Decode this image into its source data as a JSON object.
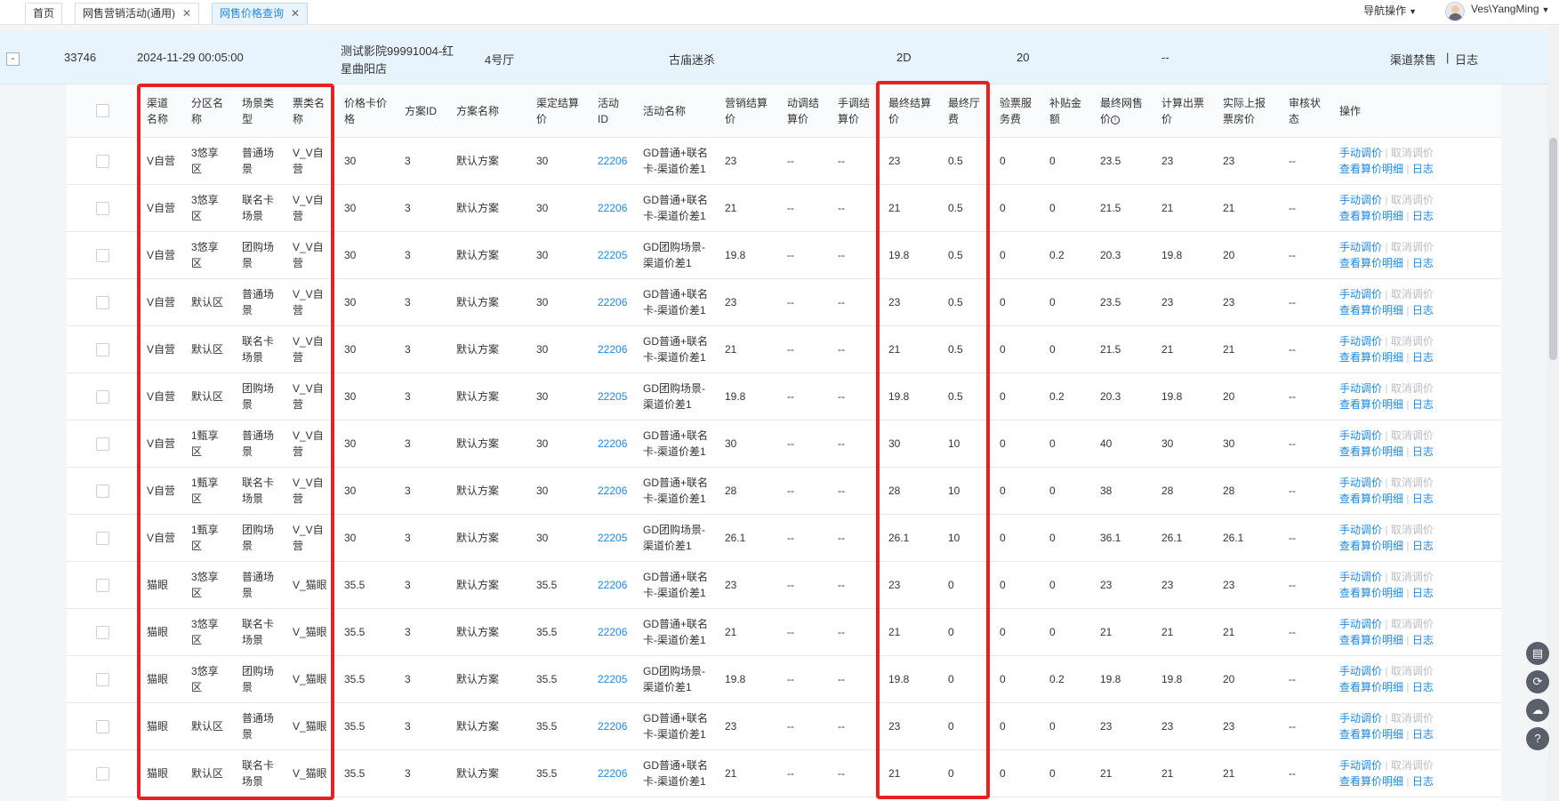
{
  "tabs": [
    {
      "label": "首页",
      "closable": false,
      "active": false
    },
    {
      "label": "网售营销活动(通用)",
      "closable": true,
      "active": false
    },
    {
      "label": "网售价格查询",
      "closable": true,
      "active": true
    }
  ],
  "header": {
    "nav_ops_label": "导航操作",
    "user_name": "Ves\\YangMing"
  },
  "summary": {
    "collapse_symbol": "-",
    "id": "33746",
    "datetime": "2024-11-29 00:05:00",
    "cinema_line1": "测试影院99991004-红",
    "cinema_line2": "星曲阳店",
    "hall": "4号厅",
    "movie": "古庙迷杀",
    "format": "2D",
    "count": "20",
    "dash": "--",
    "action_channel_ban": "渠道禁售",
    "action_log": "日志"
  },
  "columns": [
    {
      "key": "channel",
      "l1": "渠道",
      "l2": "名称"
    },
    {
      "key": "zone",
      "l1": "分区名",
      "l2": "称"
    },
    {
      "key": "scene",
      "l1": "场景类",
      "l2": "型"
    },
    {
      "key": "ticket",
      "l1": "票类名",
      "l2": "称"
    },
    {
      "key": "card",
      "l1": "价格卡价",
      "l2": "格"
    },
    {
      "key": "planid",
      "l1": "方案ID",
      "l2": ""
    },
    {
      "key": "plan",
      "l1": "方案名称",
      "l2": ""
    },
    {
      "key": "settle",
      "l1": "渠定结算",
      "l2": "价"
    },
    {
      "key": "actid",
      "l1": "活动",
      "l2": "ID"
    },
    {
      "key": "act",
      "l1": "活动名称",
      "l2": ""
    },
    {
      "key": "mkt",
      "l1": "营销结算",
      "l2": "价"
    },
    {
      "key": "dyn",
      "l1": "动调结",
      "l2": "算价"
    },
    {
      "key": "man",
      "l1": "手调结",
      "l2": "算价"
    },
    {
      "key": "final",
      "l1": "最终结算",
      "l2": "价"
    },
    {
      "key": "fee",
      "l1": "最终厅",
      "l2": "费"
    },
    {
      "key": "svc",
      "l1": "验票服",
      "l2": "务费"
    },
    {
      "key": "sub",
      "l1": "补贴金",
      "l2": "额"
    },
    {
      "key": "net",
      "l1": "最终网售",
      "l2": "价"
    },
    {
      "key": "calc",
      "l1": "计算出票",
      "l2": "价"
    },
    {
      "key": "rep",
      "l1": "实际上报",
      "l2": "票房价"
    },
    {
      "key": "audit",
      "l1": "审核状",
      "l2": "态"
    },
    {
      "key": "ops",
      "l1": "操作",
      "l2": ""
    }
  ],
  "op_labels": {
    "manual": "手动调价",
    "cancel": "取消调价",
    "detail": "查看算价明细",
    "log": "日志"
  },
  "rows": [
    {
      "channel": "V自营",
      "zone": [
        "3悠享",
        "区"
      ],
      "scene": [
        "普通场",
        "景"
      ],
      "ticket": [
        "V_V自",
        "营"
      ],
      "card": "30",
      "planid": "3",
      "plan": "默认方案",
      "settle": "30",
      "actid": "22206",
      "act": [
        "GD普通+联名",
        "卡-渠道价差1"
      ],
      "mkt": "23",
      "dyn": "--",
      "man": "--",
      "final": "23",
      "fee": "0.5",
      "svc": "0",
      "sub": "0",
      "net": "23.5",
      "calc": "23",
      "rep": "23",
      "audit": "--"
    },
    {
      "channel": "V自营",
      "zone": [
        "3悠享",
        "区"
      ],
      "scene": [
        "联名卡",
        "场景"
      ],
      "ticket": [
        "V_V自",
        "营"
      ],
      "card": "30",
      "planid": "3",
      "plan": "默认方案",
      "settle": "30",
      "actid": "22206",
      "act": [
        "GD普通+联名",
        "卡-渠道价差1"
      ],
      "mkt": "21",
      "dyn": "--",
      "man": "--",
      "final": "21",
      "fee": "0.5",
      "svc": "0",
      "sub": "0",
      "net": "21.5",
      "calc": "21",
      "rep": "21",
      "audit": "--"
    },
    {
      "channel": "V自营",
      "zone": [
        "3悠享",
        "区"
      ],
      "scene": [
        "团购场",
        "景"
      ],
      "ticket": [
        "V_V自",
        "营"
      ],
      "card": "30",
      "planid": "3",
      "plan": "默认方案",
      "settle": "30",
      "actid": "22205",
      "act": [
        "GD团购场景-",
        "渠道价差1"
      ],
      "mkt": "19.8",
      "dyn": "--",
      "man": "--",
      "final": "19.8",
      "fee": "0.5",
      "svc": "0",
      "sub": "0.2",
      "net": "20.3",
      "calc": "19.8",
      "rep": "20",
      "audit": "--"
    },
    {
      "channel": "V自营",
      "zone": [
        "默认区",
        ""
      ],
      "scene": [
        "普通场",
        "景"
      ],
      "ticket": [
        "V_V自",
        "营"
      ],
      "card": "30",
      "planid": "3",
      "plan": "默认方案",
      "settle": "30",
      "actid": "22206",
      "act": [
        "GD普通+联名",
        "卡-渠道价差1"
      ],
      "mkt": "23",
      "dyn": "--",
      "man": "--",
      "final": "23",
      "fee": "0.5",
      "svc": "0",
      "sub": "0",
      "net": "23.5",
      "calc": "23",
      "rep": "23",
      "audit": "--"
    },
    {
      "channel": "V自营",
      "zone": [
        "默认区",
        ""
      ],
      "scene": [
        "联名卡",
        "场景"
      ],
      "ticket": [
        "V_V自",
        "营"
      ],
      "card": "30",
      "planid": "3",
      "plan": "默认方案",
      "settle": "30",
      "actid": "22206",
      "act": [
        "GD普通+联名",
        "卡-渠道价差1"
      ],
      "mkt": "21",
      "dyn": "--",
      "man": "--",
      "final": "21",
      "fee": "0.5",
      "svc": "0",
      "sub": "0",
      "net": "21.5",
      "calc": "21",
      "rep": "21",
      "audit": "--"
    },
    {
      "channel": "V自营",
      "zone": [
        "默认区",
        ""
      ],
      "scene": [
        "团购场",
        "景"
      ],
      "ticket": [
        "V_V自",
        "营"
      ],
      "card": "30",
      "planid": "3",
      "plan": "默认方案",
      "settle": "30",
      "actid": "22205",
      "act": [
        "GD团购场景-",
        "渠道价差1"
      ],
      "mkt": "19.8",
      "dyn": "--",
      "man": "--",
      "final": "19.8",
      "fee": "0.5",
      "svc": "0",
      "sub": "0.2",
      "net": "20.3",
      "calc": "19.8",
      "rep": "20",
      "audit": "--"
    },
    {
      "channel": "V自营",
      "zone": [
        "1甄享",
        "区"
      ],
      "scene": [
        "普通场",
        "景"
      ],
      "ticket": [
        "V_V自",
        "营"
      ],
      "card": "30",
      "planid": "3",
      "plan": "默认方案",
      "settle": "30",
      "actid": "22206",
      "act": [
        "GD普通+联名",
        "卡-渠道价差1"
      ],
      "mkt": "30",
      "dyn": "--",
      "man": "--",
      "final": "30",
      "fee": "10",
      "svc": "0",
      "sub": "0",
      "net": "40",
      "calc": "30",
      "rep": "30",
      "audit": "--"
    },
    {
      "channel": "V自营",
      "zone": [
        "1甄享",
        "区"
      ],
      "scene": [
        "联名卡",
        "场景"
      ],
      "ticket": [
        "V_V自",
        "营"
      ],
      "card": "30",
      "planid": "3",
      "plan": "默认方案",
      "settle": "30",
      "actid": "22206",
      "act": [
        "GD普通+联名",
        "卡-渠道价差1"
      ],
      "mkt": "28",
      "dyn": "--",
      "man": "--",
      "final": "28",
      "fee": "10",
      "svc": "0",
      "sub": "0",
      "net": "38",
      "calc": "28",
      "rep": "28",
      "audit": "--"
    },
    {
      "channel": "V自营",
      "zone": [
        "1甄享",
        "区"
      ],
      "scene": [
        "团购场",
        "景"
      ],
      "ticket": [
        "V_V自",
        "营"
      ],
      "card": "30",
      "planid": "3",
      "plan": "默认方案",
      "settle": "30",
      "actid": "22205",
      "act": [
        "GD团购场景-",
        "渠道价差1"
      ],
      "mkt": "26.1",
      "dyn": "--",
      "man": "--",
      "final": "26.1",
      "fee": "10",
      "svc": "0",
      "sub": "0",
      "net": "36.1",
      "calc": "26.1",
      "rep": "26.1",
      "audit": "--"
    },
    {
      "channel": "猫眼",
      "zone": [
        "3悠享",
        "区"
      ],
      "scene": [
        "普通场",
        "景"
      ],
      "ticket": [
        "V_猫眼",
        ""
      ],
      "card": "35.5",
      "planid": "3",
      "plan": "默认方案",
      "settle": "35.5",
      "actid": "22206",
      "act": [
        "GD普通+联名",
        "卡-渠道价差1"
      ],
      "mkt": "23",
      "dyn": "--",
      "man": "--",
      "final": "23",
      "fee": "0",
      "svc": "0",
      "sub": "0",
      "net": "23",
      "calc": "23",
      "rep": "23",
      "audit": "--"
    },
    {
      "channel": "猫眼",
      "zone": [
        "3悠享",
        "区"
      ],
      "scene": [
        "联名卡",
        "场景"
      ],
      "ticket": [
        "V_猫眼",
        ""
      ],
      "card": "35.5",
      "planid": "3",
      "plan": "默认方案",
      "settle": "35.5",
      "actid": "22206",
      "act": [
        "GD普通+联名",
        "卡-渠道价差1"
      ],
      "mkt": "21",
      "dyn": "--",
      "man": "--",
      "final": "21",
      "fee": "0",
      "svc": "0",
      "sub": "0",
      "net": "21",
      "calc": "21",
      "rep": "21",
      "audit": "--"
    },
    {
      "channel": "猫眼",
      "zone": [
        "3悠享",
        "区"
      ],
      "scene": [
        "团购场",
        "景"
      ],
      "ticket": [
        "V_猫眼",
        ""
      ],
      "card": "35.5",
      "planid": "3",
      "plan": "默认方案",
      "settle": "35.5",
      "actid": "22205",
      "act": [
        "GD团购场景-",
        "渠道价差1"
      ],
      "mkt": "19.8",
      "dyn": "--",
      "man": "--",
      "final": "19.8",
      "fee": "0",
      "svc": "0",
      "sub": "0.2",
      "net": "19.8",
      "calc": "19.8",
      "rep": "20",
      "audit": "--"
    },
    {
      "channel": "猫眼",
      "zone": [
        "默认区",
        ""
      ],
      "scene": [
        "普通场",
        "景"
      ],
      "ticket": [
        "V_猫眼",
        ""
      ],
      "card": "35.5",
      "planid": "3",
      "plan": "默认方案",
      "settle": "35.5",
      "actid": "22206",
      "act": [
        "GD普通+联名",
        "卡-渠道价差1"
      ],
      "mkt": "23",
      "dyn": "--",
      "man": "--",
      "final": "23",
      "fee": "0",
      "svc": "0",
      "sub": "0",
      "net": "23",
      "calc": "23",
      "rep": "23",
      "audit": "--"
    },
    {
      "channel": "猫眼",
      "zone": [
        "默认区",
        ""
      ],
      "scene": [
        "联名卡",
        "场景"
      ],
      "ticket": [
        "V_猫眼",
        ""
      ],
      "card": "35.5",
      "planid": "3",
      "plan": "默认方案",
      "settle": "35.5",
      "actid": "22206",
      "act": [
        "GD普通+联名",
        "卡-渠道价差1"
      ],
      "mkt": "21",
      "dyn": "--",
      "man": "--",
      "final": "21",
      "fee": "0",
      "svc": "0",
      "sub": "0",
      "net": "21",
      "calc": "21",
      "rep": "21",
      "audit": "--"
    }
  ],
  "float_buttons": [
    {
      "name": "layout-icon",
      "glyph": "▤"
    },
    {
      "name": "refresh-icon",
      "glyph": "⟳"
    },
    {
      "name": "cloud-upload-icon",
      "glyph": "☁"
    },
    {
      "name": "help-icon",
      "glyph": "?"
    }
  ],
  "colors": {
    "accent": "#1e88e5",
    "highlight_box": "#e82020",
    "summary_bg": "#e8f4fd"
  }
}
